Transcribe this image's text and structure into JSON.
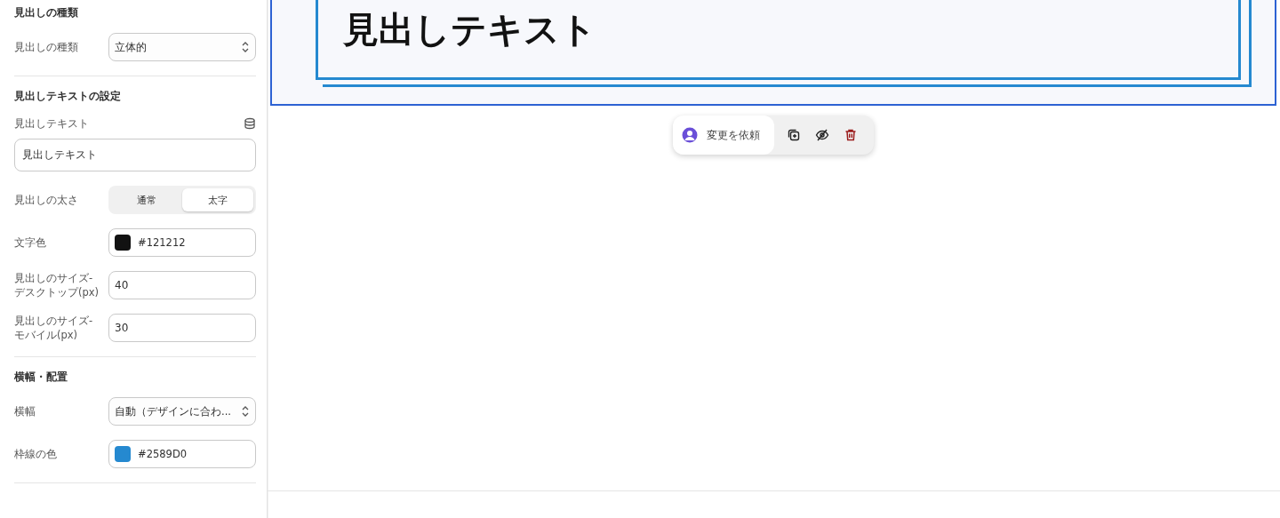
{
  "sidebar": {
    "sections": [
      {
        "title": "見出しの種類",
        "fields": [
          {
            "kind": "select",
            "label": "見出しの種類",
            "value": "立体的"
          }
        ]
      },
      {
        "title": "見出しテキストの設定",
        "fields": [
          {
            "kind": "text",
            "label": "見出しテキスト",
            "value": "見出しテキスト"
          },
          {
            "kind": "segmented",
            "label": "見出しの太さ",
            "options": [
              {
                "label": "通常",
                "selected": false
              },
              {
                "label": "太字",
                "selected": true
              }
            ]
          },
          {
            "kind": "color",
            "label": "文字色",
            "value": "#121212",
            "color": "#121212"
          },
          {
            "kind": "number",
            "label": "見出しのサイズ-\nデスクトップ(px)",
            "value": "40"
          },
          {
            "kind": "number",
            "label": "見出しのサイズ-\nモバイル(px)",
            "value": "30"
          }
        ]
      },
      {
        "title": "横幅・配置",
        "fields": [
          {
            "kind": "select",
            "label": "横幅",
            "value": "自動（デザインに合わ..."
          },
          {
            "kind": "color",
            "label": "枠線の色",
            "value": "#2589D0",
            "color": "#2589D0"
          }
        ]
      }
    ]
  },
  "preview": {
    "heading": "見出しテキスト",
    "selected": true
  },
  "toolbar": {
    "request_button": "変更を依頼",
    "actions": [
      {
        "kind": "duplicate"
      },
      {
        "kind": "hide"
      },
      {
        "kind": "delete"
      }
    ]
  }
}
